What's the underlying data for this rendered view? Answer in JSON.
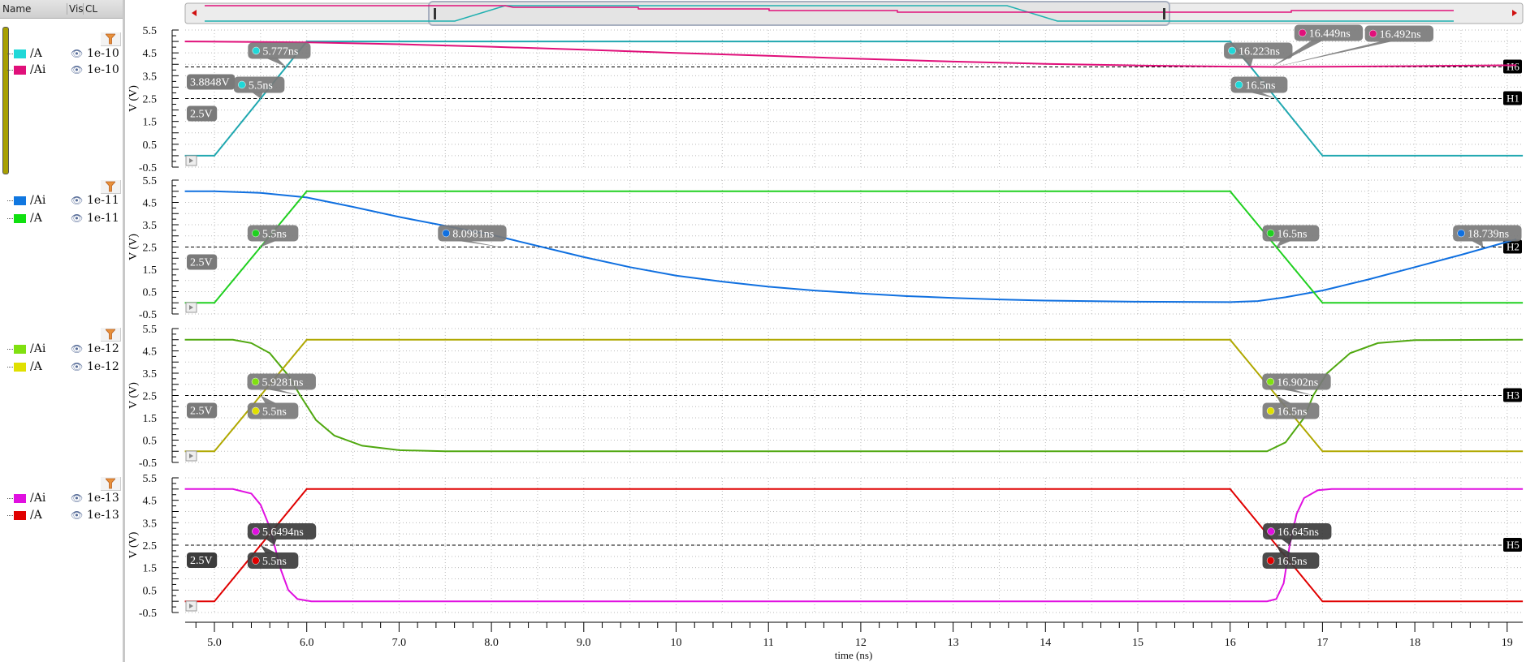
{
  "signal_list": {
    "headers": {
      "name": "Name",
      "vis": "Vis",
      "cl": "CL"
    },
    "groups": [
      {
        "signals": [
          {
            "name": "/A",
            "cl": "1e-10",
            "color": "#20d8d8"
          },
          {
            "name": "/Ai",
            "cl": "1e-10",
            "color": "#e0107a"
          }
        ]
      },
      {
        "signals": [
          {
            "name": "/Ai",
            "cl": "1e-11",
            "color": "#1077e0"
          },
          {
            "name": "/A",
            "cl": "1e-11",
            "color": "#10e010"
          }
        ]
      },
      {
        "signals": [
          {
            "name": "/Ai",
            "cl": "1e-12",
            "color": "#80e010"
          },
          {
            "name": "/A",
            "cl": "1e-12",
            "color": "#e0e000"
          }
        ]
      },
      {
        "signals": [
          {
            "name": "/Ai",
            "cl": "1e-13",
            "color": "#e010e0"
          },
          {
            "name": "/A",
            "cl": "1e-13",
            "color": "#e00000"
          }
        ]
      }
    ]
  },
  "chart_data": {
    "type": "line",
    "xlabel": "time (ns)",
    "ylabel": "V (V)",
    "xlim": [
      4.68,
      19.17
    ],
    "x_ticks": [
      "5.0",
      "6.0",
      "7.0",
      "8.0",
      "9.0",
      "10",
      "11",
      "12",
      "13",
      "14",
      "15",
      "16",
      "17",
      "18",
      "19"
    ],
    "y_ticks": [
      "5.5",
      "4.5",
      "3.5",
      "2.5",
      "1.5",
      "0.5",
      "-0.5"
    ],
    "ylim": [
      -0.5,
      5.5
    ],
    "grid": true,
    "panels": [
      {
        "series": [
          {
            "name": "/A",
            "color": "#20a8b0",
            "points": [
              [
                4.68,
                0
              ],
              [
                5,
                0
              ],
              [
                6,
                5
              ],
              [
                16,
                5
              ],
              [
                17,
                0
              ],
              [
                19.17,
                0
              ]
            ]
          },
          {
            "name": "/Ai",
            "color": "#e0107a",
            "points": [
              [
                4.68,
                5
              ],
              [
                6,
                4.96
              ],
              [
                7,
                4.88
              ],
              [
                8,
                4.77
              ],
              [
                9,
                4.64
              ],
              [
                10,
                4.5
              ],
              [
                11,
                4.37
              ],
              [
                12,
                4.24
              ],
              [
                13,
                4.12
              ],
              [
                14,
                4.02
              ],
              [
                15,
                3.95
              ],
              [
                16,
                3.9
              ],
              [
                16.5,
                3.885
              ],
              [
                17,
                3.89
              ],
              [
                18,
                3.92
              ],
              [
                19.1,
                3.96
              ]
            ]
          }
        ],
        "hlines": [
          {
            "value": 3.8848,
            "label": "3.8848V",
            "tag": "H6"
          },
          {
            "value": 2.5,
            "label": "2.5V",
            "tag": "H1"
          }
        ],
        "markers": [
          {
            "label": "5.777ns",
            "t": 5.777,
            "v": 3.8848,
            "color": "#20d8d8"
          },
          {
            "label": "5.5ns",
            "t": 5.5,
            "v": 2.5,
            "color": "#20d8d8"
          },
          {
            "label": "16.223ns",
            "t": 16.223,
            "v": 3.8848,
            "color": "#20d8d8"
          },
          {
            "label": "16.5ns",
            "t": 16.5,
            "v": 2.5,
            "color": "#20d8d8"
          },
          {
            "label": "16.449ns",
            "t": 16.449,
            "v": 3.8848,
            "color": "#e0107a"
          },
          {
            "label": "16.492ns",
            "t": 16.492,
            "v": 3.8848,
            "color": "#e0107a"
          }
        ]
      },
      {
        "series": [
          {
            "name": "/Ai",
            "color": "#1070e0",
            "points": [
              [
                4.68,
                5
              ],
              [
                5,
                5
              ],
              [
                5.5,
                4.93
              ],
              [
                6,
                4.72
              ],
              [
                6.5,
                4.3
              ],
              [
                7,
                3.85
              ],
              [
                7.5,
                3.45
              ],
              [
                8,
                3.05
              ],
              [
                8.5,
                2.55
              ],
              [
                9,
                2.05
              ],
              [
                9.5,
                1.6
              ],
              [
                10,
                1.22
              ],
              [
                10.5,
                0.95
              ],
              [
                11,
                0.72
              ],
              [
                11.5,
                0.55
              ],
              [
                12,
                0.42
              ],
              [
                12.5,
                0.3
              ],
              [
                13,
                0.22
              ],
              [
                13.5,
                0.15
              ],
              [
                14,
                0.1
              ],
              [
                15,
                0.05
              ],
              [
                16,
                0.03
              ],
              [
                16.3,
                0.08
              ],
              [
                16.6,
                0.25
              ],
              [
                17,
                0.55
              ],
              [
                17.5,
                1.05
              ],
              [
                18,
                1.6
              ],
              [
                18.5,
                2.15
              ],
              [
                19.1,
                2.85
              ]
            ]
          },
          {
            "name": "/A",
            "color": "#20d020",
            "points": [
              [
                4.68,
                0
              ],
              [
                5,
                0
              ],
              [
                6,
                5
              ],
              [
                16,
                5
              ],
              [
                17,
                0
              ],
              [
                19.17,
                0
              ]
            ]
          }
        ],
        "hlines": [
          {
            "value": 2.5,
            "label": "2.5V",
            "tag": "H2"
          }
        ],
        "markers": [
          {
            "label": "5.5ns",
            "t": 5.5,
            "v": 2.5,
            "color": "#20d020"
          },
          {
            "label": "8.0981ns",
            "t": 8.0981,
            "v": 2.5,
            "color": "#1070e0"
          },
          {
            "label": "16.5ns",
            "t": 16.5,
            "v": 2.5,
            "color": "#20d020"
          },
          {
            "label": "18.739ns",
            "t": 18.739,
            "v": 2.5,
            "color": "#1070e0"
          }
        ]
      },
      {
        "series": [
          {
            "name": "/Ai",
            "color": "#50a810",
            "points": [
              [
                4.68,
                5
              ],
              [
                5.2,
                5
              ],
              [
                5.4,
                4.85
              ],
              [
                5.6,
                4.4
              ],
              [
                5.8,
                3.4
              ],
              [
                5.93,
                2.5
              ],
              [
                6.1,
                1.4
              ],
              [
                6.3,
                0.7
              ],
              [
                6.6,
                0.25
              ],
              [
                7,
                0.05
              ],
              [
                7.5,
                0
              ],
              [
                16.4,
                0
              ],
              [
                16.6,
                0.4
              ],
              [
                16.8,
                1.5
              ],
              [
                16.9,
                2.5
              ],
              [
                17.05,
                3.5
              ],
              [
                17.3,
                4.4
              ],
              [
                17.6,
                4.85
              ],
              [
                18,
                4.98
              ],
              [
                19.17,
                5
              ]
            ]
          },
          {
            "name": "/A",
            "color": "#b0a800",
            "points": [
              [
                4.68,
                0
              ],
              [
                5,
                0
              ],
              [
                6,
                5
              ],
              [
                16,
                5
              ],
              [
                17,
                0
              ],
              [
                19.17,
                0
              ]
            ]
          }
        ],
        "hlines": [
          {
            "value": 2.5,
            "label": "2.5V",
            "tag": "H3"
          }
        ],
        "markers": [
          {
            "label": "5.9281ns",
            "t": 5.9281,
            "v": 2.5,
            "color": "#80e010"
          },
          {
            "label": "5.5ns",
            "t": 5.5,
            "v": 2.5,
            "color": "#e0e000"
          },
          {
            "label": "16.902ns",
            "t": 16.902,
            "v": 2.5,
            "color": "#80e010"
          },
          {
            "label": "16.5ns",
            "t": 16.5,
            "v": 2.5,
            "color": "#e0e000"
          }
        ]
      },
      {
        "series": [
          {
            "name": "/Ai",
            "color": "#e010e0",
            "points": [
              [
                4.68,
                5
              ],
              [
                5.2,
                5
              ],
              [
                5.4,
                4.8
              ],
              [
                5.5,
                4.3
              ],
              [
                5.6,
                3.3
              ],
              [
                5.65,
                2.5
              ],
              [
                5.72,
                1.4
              ],
              [
                5.8,
                0.5
              ],
              [
                5.9,
                0.1
              ],
              [
                6.05,
                0
              ],
              [
                16.4,
                0
              ],
              [
                16.5,
                0.1
              ],
              [
                16.58,
                0.8
              ],
              [
                16.645,
                2.5
              ],
              [
                16.72,
                3.9
              ],
              [
                16.8,
                4.6
              ],
              [
                16.95,
                4.95
              ],
              [
                17.1,
                5
              ],
              [
                19.17,
                5
              ]
            ]
          },
          {
            "name": "/A",
            "color": "#e00000",
            "points": [
              [
                4.68,
                0
              ],
              [
                5,
                0
              ],
              [
                6,
                5
              ],
              [
                16,
                5
              ],
              [
                17,
                0
              ],
              [
                19.17,
                0
              ]
            ]
          }
        ],
        "hlines": [
          {
            "value": 2.5,
            "label": "2.5V",
            "tag": "H5"
          }
        ],
        "markers": [
          {
            "label": "5.6494ns",
            "t": 5.6494,
            "v": 2.5,
            "color": "#e010e0"
          },
          {
            "label": "5.5ns",
            "t": 5.5,
            "v": 2.5,
            "color": "#e00000"
          },
          {
            "label": "16.645ns",
            "t": 16.645,
            "v": 2.5,
            "color": "#e010e0"
          },
          {
            "label": "16.5ns",
            "t": 16.5,
            "v": 2.5,
            "color": "#e00000"
          }
        ]
      }
    ]
  }
}
